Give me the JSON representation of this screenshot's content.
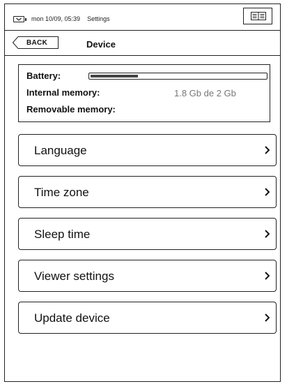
{
  "status_bar": {
    "datetime": "mon 10/09, 05:39",
    "app_name": "Settings",
    "battery_icon": "battery-charging-icon",
    "menu_icon": "menu-grid-icon"
  },
  "header": {
    "back_label": "BACK",
    "title": "Device"
  },
  "device_info": {
    "battery_label": "Battery:",
    "battery_level": 0.27,
    "internal_label": "Internal memory:",
    "internal_value": "1.8 Gb de 2 Gb",
    "removable_label": "Removable memory:",
    "removable_value": ""
  },
  "menu": {
    "items": [
      {
        "label": "Language"
      },
      {
        "label": "Time zone"
      },
      {
        "label": "Sleep time"
      },
      {
        "label": "Viewer settings"
      },
      {
        "label": "Update device"
      }
    ],
    "chevron_icon": "chevron-right-icon"
  },
  "colors": {
    "ink": "#111111",
    "muted": "#777777",
    "background": "#ffffff"
  }
}
